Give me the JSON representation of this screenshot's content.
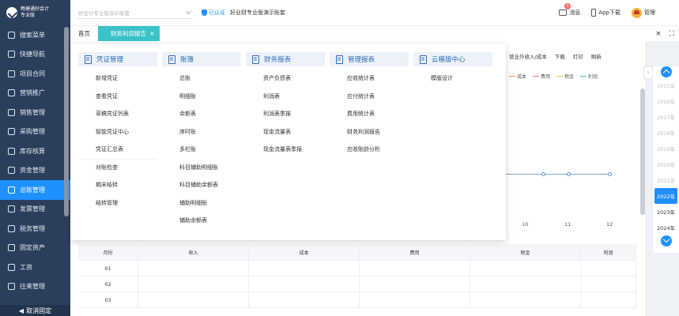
{
  "sidebar": {
    "logo_line1": "畅捷通好会计",
    "logo_line2": "专业版",
    "items": [
      {
        "label": "搜索菜单",
        "icon": "search-icon"
      },
      {
        "label": "快捷导航",
        "icon": "home-icon"
      },
      {
        "label": "项目合同",
        "icon": "document-icon"
      },
      {
        "label": "营销推广",
        "icon": "gift-icon"
      },
      {
        "label": "销售管理",
        "icon": "cart-icon"
      },
      {
        "label": "采购管理",
        "icon": "bag-icon"
      },
      {
        "label": "库存核算",
        "icon": "warehouse-icon"
      },
      {
        "label": "资金管理",
        "icon": "money-icon"
      },
      {
        "label": "总账管理",
        "icon": "ledger-icon"
      },
      {
        "label": "发票管理",
        "icon": "invoice-icon"
      },
      {
        "label": "税务管理",
        "icon": "tax-icon"
      },
      {
        "label": "固定资产",
        "icon": "asset-icon"
      },
      {
        "label": "工资",
        "icon": "wallet-icon"
      },
      {
        "label": "往来管理",
        "icon": "contacts-icon"
      }
    ],
    "active_index": 8,
    "footer_label": "取消固定"
  },
  "topbar": {
    "company_placeholder": "好会计专业版演示账套",
    "verified_label": "已认证",
    "tagline": "好业财专业版演示账套",
    "messages_label": "消息",
    "messages_count": "1",
    "app_download_label": "App下载",
    "user_label": "管理"
  },
  "tabs": {
    "home_label": "首页",
    "active_label": "财务利润报告",
    "close_glyph": "×",
    "right_close": "×",
    "right_expand": "⛶"
  },
  "content": {
    "toolbar": [
      "营业外收入/成本",
      "下载",
      "打印",
      "刷新"
    ],
    "legend": [
      {
        "label": "成本",
        "color": "#e6a23c"
      },
      {
        "label": "费用",
        "color": "#f56c6c"
      },
      {
        "label": "税金",
        "color": "#e6c23c"
      },
      {
        "label": "利润",
        "color": "#3ac2c8"
      }
    ],
    "chart_x_labels": [
      "10",
      "11",
      "12"
    ],
    "table_headers": [
      "月份",
      "收入",
      "成本",
      "费用",
      "税金",
      "利润"
    ],
    "table_rows": [
      "01",
      "02",
      "03"
    ]
  },
  "years": {
    "list": [
      "2015年",
      "2016年",
      "2017年",
      "2018年",
      "2019年",
      "2020年",
      "2021年",
      "2022年",
      "2023年",
      "2024年"
    ],
    "active": "2022年"
  },
  "mega_menu": {
    "columns": [
      {
        "title": "凭证管理",
        "items": [
          "新增凭证",
          "查看凭证",
          "草稿凭证列表",
          "智能凭证中心",
          "凭证汇总表",
          "对账检查",
          "期末结转",
          "结转管理"
        ]
      },
      {
        "title": "账簿",
        "items": [
          "总账",
          "明细账",
          "余额表",
          "序时账",
          "多栏账",
          "科目辅助明细账",
          "科目辅助余额表",
          "辅助明细账",
          "辅助余额表"
        ]
      },
      {
        "title": "财务报表",
        "items": [
          "资产负债表",
          "利润表",
          "利润表季报",
          "现金流量表",
          "现金流量表季报"
        ]
      },
      {
        "title": "管理报表",
        "items": [
          "应收统计表",
          "应付统计表",
          "费用统计表",
          "财务利润报告",
          "应收账龄分析"
        ]
      },
      {
        "title": "云模版中心",
        "items": [
          "模版设计"
        ]
      }
    ]
  }
}
